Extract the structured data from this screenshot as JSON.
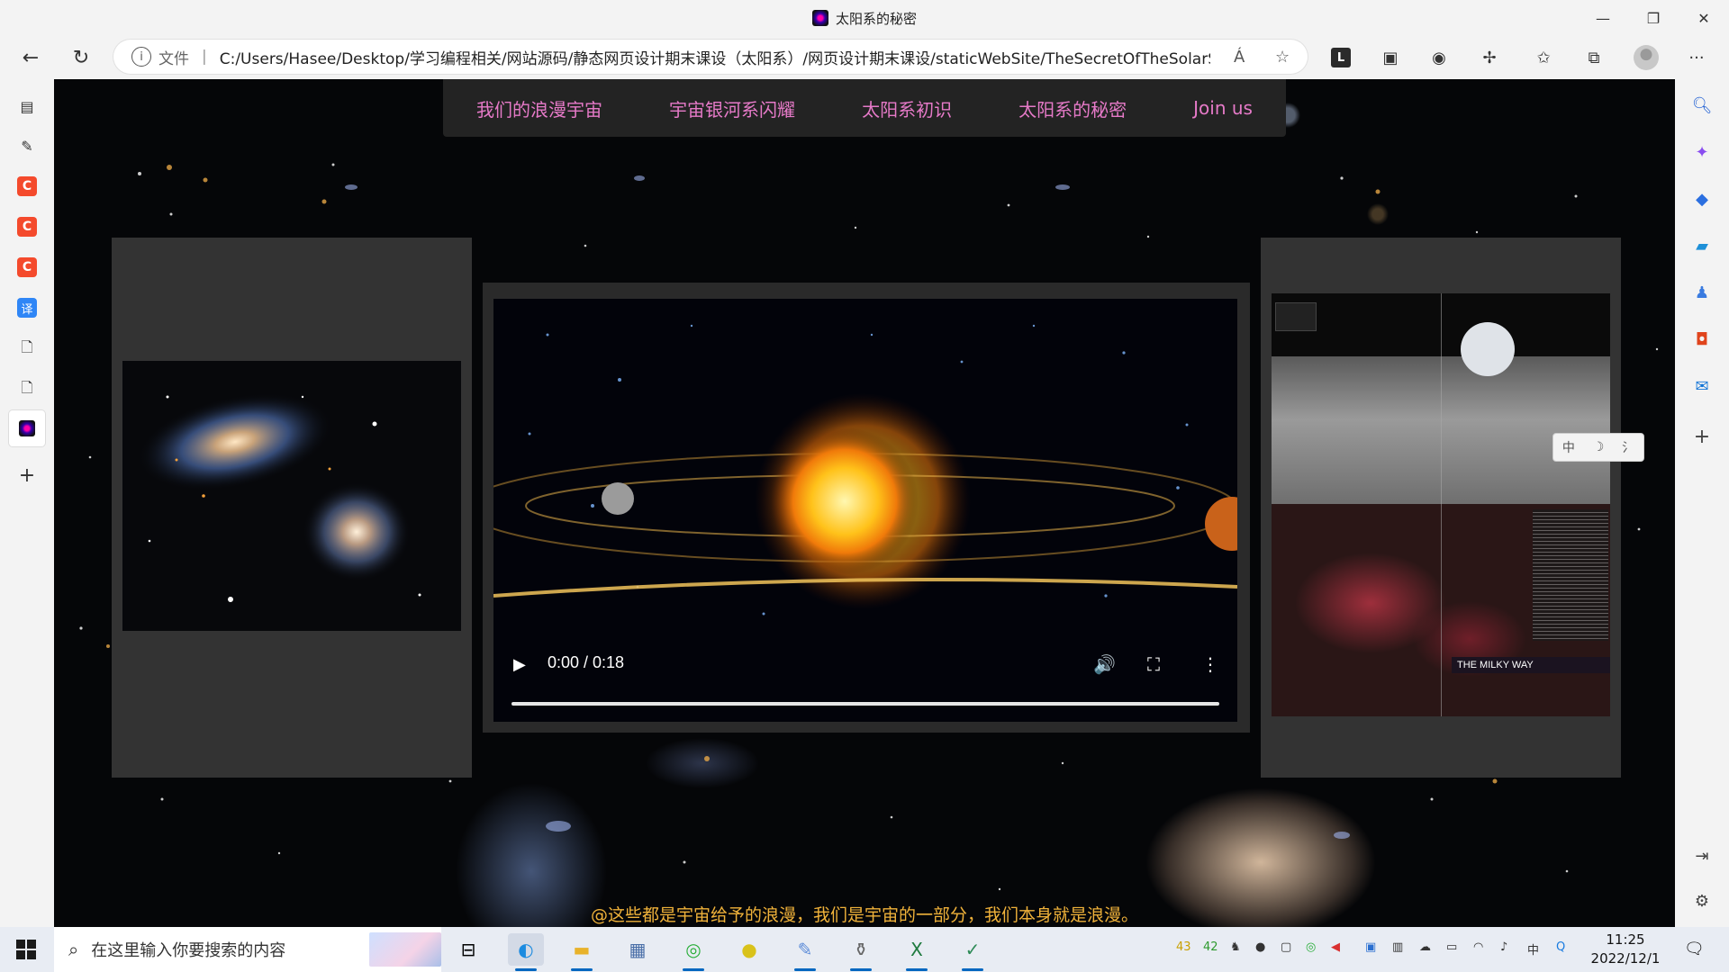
{
  "window": {
    "title": "太阳系的秘密",
    "controls": {
      "minimize": "—",
      "restore": "❐",
      "close": "✕"
    }
  },
  "toolbar": {
    "back_icon": "←",
    "refresh_icon": "↻",
    "protocol_label": "文件",
    "url": "C:/Users/Hasee/Desktop/学习编程相关/网站源码/静态网页设计期末课设（太阳系）/网页设计期末课设/staticWebSite/TheSecretOfTheSolarSys...",
    "read_aloud_icon": "Á",
    "favorite_icon": "☆",
    "ext1": "L",
    "menu_icon": "···"
  },
  "site_nav": {
    "items": [
      "我们的浪漫宇宙",
      "宇宙银河系闪耀",
      "太阳系初识",
      "太阳系的秘密",
      "Join us"
    ]
  },
  "colors": {
    "nav_text": "#e67ac8",
    "caption_text": "#f0b23a",
    "panel_bg": "#333333"
  },
  "video": {
    "time": "0:00 / 0:18",
    "play_icon": "▶",
    "volume_icon": "🔊",
    "fullscreen_icon": "⛶",
    "more_icon": "⋮"
  },
  "right_image": {
    "label": "THE MILKY WAY"
  },
  "translate_widget": [
    "中",
    "☽",
    "⺡"
  ],
  "caption": "@这些都是宇宙给予的浪漫，我们是宇宙的一部分，我们本身就是浪漫。",
  "taskbar": {
    "search_placeholder": "在这里输入你要搜索的内容",
    "tray_numbers": [
      "43",
      "42"
    ],
    "ime": "中",
    "time": "11:25",
    "date": "2022/12/1"
  }
}
